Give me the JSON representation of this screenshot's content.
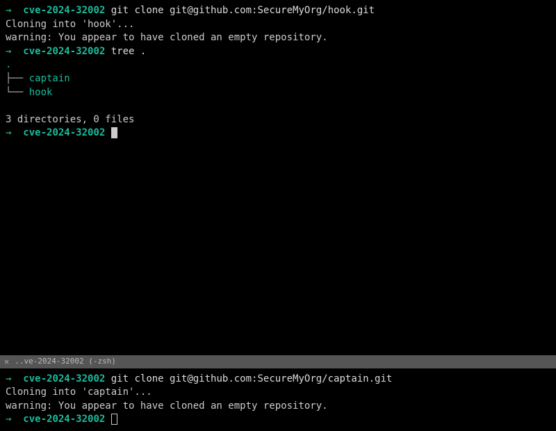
{
  "top": {
    "line1": {
      "arrow": "→",
      "dir": "cve-2024-32002",
      "cmd": "git clone git@github.com:SecureMyOrg/hook.git"
    },
    "line2": "Cloning into 'hook'...",
    "line3": "warning: You appear to have cloned an empty repository.",
    "line4": {
      "arrow": "→",
      "dir": "cve-2024-32002",
      "cmd": "tree ."
    },
    "tree": {
      "dot": ".",
      "branch1": "├── ",
      "item1": "captain",
      "branch2": "└── ",
      "item2": "hook"
    },
    "summary": "3 directories, 0 files",
    "line5": {
      "arrow": "→",
      "dir": "cve-2024-32002"
    }
  },
  "tab": {
    "close": "✕",
    "title": "..ve-2024-32002 (-zsh)"
  },
  "bottom": {
    "line1": {
      "arrow": "→",
      "dir": "cve-2024-32002",
      "cmd": "git clone git@github.com:SecureMyOrg/captain.git"
    },
    "line2": "Cloning into 'captain'...",
    "line3": "warning: You appear to have cloned an empty repository.",
    "line4": {
      "arrow": "→",
      "dir": "cve-2024-32002"
    }
  }
}
